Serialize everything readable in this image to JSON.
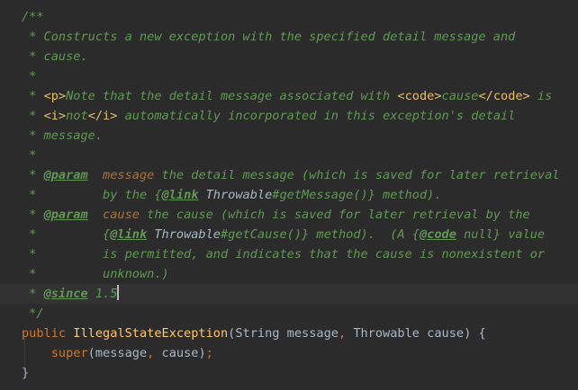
{
  "editor": {
    "lines": [
      {
        "tokens": [
          {
            "cls": "doc",
            "text": "/**"
          }
        ]
      },
      {
        "tokens": [
          {
            "cls": "doc",
            "text": " * Constructs a new exception with the specified detail message and"
          }
        ]
      },
      {
        "tokens": [
          {
            "cls": "doc",
            "text": " * cause."
          }
        ]
      },
      {
        "tokens": [
          {
            "cls": "doc",
            "text": " *"
          }
        ]
      },
      {
        "tokens": [
          {
            "cls": "doc",
            "text": " * "
          },
          {
            "cls": "doc-html",
            "text": "<p>"
          },
          {
            "cls": "doc",
            "text": "Note that the detail message associated with "
          },
          {
            "cls": "doc-html",
            "text": "<code>"
          },
          {
            "cls": "doc",
            "text": "cause"
          },
          {
            "cls": "doc-html",
            "text": "</code>"
          },
          {
            "cls": "doc",
            "text": " is"
          }
        ]
      },
      {
        "tokens": [
          {
            "cls": "doc",
            "text": " * "
          },
          {
            "cls": "doc-html",
            "text": "<i>"
          },
          {
            "cls": "doc",
            "text": "not"
          },
          {
            "cls": "doc-html",
            "text": "</i>"
          },
          {
            "cls": "doc",
            "text": " automatically incorporated in this exception's detail"
          }
        ]
      },
      {
        "tokens": [
          {
            "cls": "doc",
            "text": " * message."
          }
        ]
      },
      {
        "tokens": [
          {
            "cls": "doc",
            "text": " *"
          }
        ]
      },
      {
        "tokens": [
          {
            "cls": "doc",
            "text": " * "
          },
          {
            "cls": "doc-tag",
            "text": "@param"
          },
          {
            "cls": "doc",
            "text": "  "
          },
          {
            "cls": "doc-param",
            "text": "message"
          },
          {
            "cls": "doc",
            "text": " the detail message (which is saved for later retrieval"
          }
        ]
      },
      {
        "tokens": [
          {
            "cls": "doc",
            "text": " *         by the "
          },
          {
            "cls": "doc",
            "text": "{"
          },
          {
            "cls": "doc-tag",
            "text": "@link"
          },
          {
            "cls": "doc",
            "text": " "
          },
          {
            "cls": "doc-ref",
            "text": "Throwable"
          },
          {
            "cls": "doc",
            "text": "#getMessage()} method)."
          }
        ]
      },
      {
        "tokens": [
          {
            "cls": "doc",
            "text": " * "
          },
          {
            "cls": "doc-tag",
            "text": "@param"
          },
          {
            "cls": "doc",
            "text": "  "
          },
          {
            "cls": "doc-param",
            "text": "cause"
          },
          {
            "cls": "doc",
            "text": " the cause (which is saved for later retrieval by the"
          }
        ]
      },
      {
        "tokens": [
          {
            "cls": "doc",
            "text": " *         "
          },
          {
            "cls": "doc",
            "text": "{"
          },
          {
            "cls": "doc-tag",
            "text": "@link"
          },
          {
            "cls": "doc",
            "text": " "
          },
          {
            "cls": "doc-ref",
            "text": "Throwable"
          },
          {
            "cls": "doc",
            "text": "#getCause()} method).  (A "
          },
          {
            "cls": "doc",
            "text": "{"
          },
          {
            "cls": "doc-tag",
            "text": "@code"
          },
          {
            "cls": "doc",
            "text": " null} value"
          }
        ]
      },
      {
        "tokens": [
          {
            "cls": "doc",
            "text": " *         is permitted, and indicates that the cause is nonexistent or"
          }
        ]
      },
      {
        "tokens": [
          {
            "cls": "doc",
            "text": " *         unknown.)"
          }
        ]
      },
      {
        "tokens": [
          {
            "cls": "doc",
            "text": " * "
          },
          {
            "cls": "doc-tag",
            "text": "@since"
          },
          {
            "cls": "doc",
            "text": " 1.5"
          }
        ],
        "current": true
      },
      {
        "tokens": [
          {
            "cls": "doc",
            "text": " */"
          }
        ]
      },
      {
        "tokens": [
          {
            "cls": "kw",
            "text": "public "
          },
          {
            "cls": "fn",
            "text": "IllegalStateException"
          },
          {
            "cls": "ident",
            "text": "(String message"
          },
          {
            "cls": "punct",
            "text": ", "
          },
          {
            "cls": "ident",
            "text": "Throwable cause) {"
          }
        ]
      },
      {
        "tokens": [
          {
            "cls": "ident",
            "text": "    "
          },
          {
            "cls": "super",
            "text": "super"
          },
          {
            "cls": "ident",
            "text": "(message"
          },
          {
            "cls": "punct",
            "text": ", "
          },
          {
            "cls": "ident",
            "text": "cause)"
          },
          {
            "cls": "punct",
            "text": ";"
          }
        ]
      },
      {
        "tokens": [
          {
            "cls": "ident",
            "text": "}"
          }
        ]
      }
    ]
  }
}
